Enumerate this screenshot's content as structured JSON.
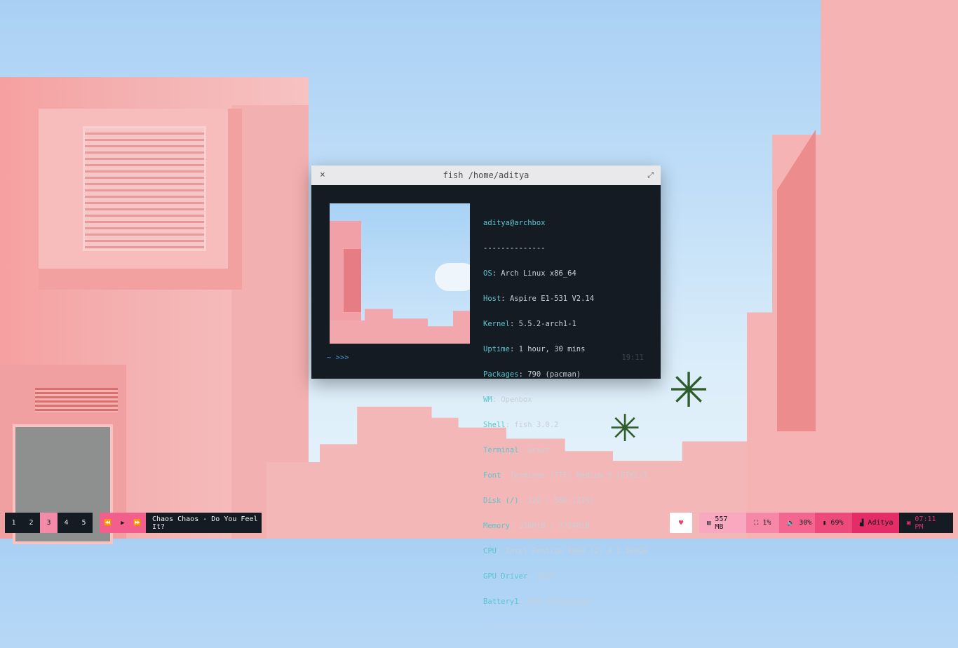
{
  "terminal": {
    "title": "fish /home/aditya",
    "close_icon": "×",
    "expand_icon": "⤢",
    "header": "aditya@archbox",
    "divider": "--------------",
    "info": [
      {
        "key": "OS",
        "value": " Arch Linux x86_64"
      },
      {
        "key": "Host",
        "value": " Aspire E1-531 V2.14"
      },
      {
        "key": "Kernel",
        "value": " 5.5.2-arch1-1"
      },
      {
        "key": "Uptime",
        "value": " 1 hour, 30 mins"
      },
      {
        "key": "Packages",
        "value": " 790 (pacman)"
      },
      {
        "key": "WM",
        "value": " Openbox"
      },
      {
        "key": "Shell",
        "value": " fish 3.0.2"
      },
      {
        "key": "Terminal",
        "value": " urxvt"
      },
      {
        "key": "Font",
        "value": " Terminus (TTF) Medium 9 [GTK2/3"
      },
      {
        "key": "Disk (/)",
        "value": " 12G / 58G (21%)"
      },
      {
        "key": "Memory",
        "value": " 336MiB / 3754MiB"
      },
      {
        "key": "CPU",
        "value": " Intel Pentium B960 (2) @ 2.200GH"
      },
      {
        "key": "GPU Driver",
        "value": " i915"
      },
      {
        "key": "Battery1",
        "value": " 68% [Charging]"
      }
    ],
    "footer_divider": "------------------------",
    "prompt": "~ >>>",
    "clock": "19:11"
  },
  "bar": {
    "workspaces": [
      "1",
      "2",
      "3",
      "4",
      "5"
    ],
    "active_workspace_index": 2,
    "media": {
      "prev_icon": "⏪",
      "play_icon": "▶",
      "next_icon": "⏩"
    },
    "song": "Chaos Chaos - Do You Feel It?",
    "heart_icon": "♥",
    "memory": {
      "icon": "▤",
      "value": "557 MB"
    },
    "cpu": {
      "icon": "⛶",
      "value": "1%"
    },
    "volume": {
      "icon": "🔈",
      "value": "30%"
    },
    "battery": {
      "icon": "▮",
      "value": "69%"
    },
    "wifi": {
      "icon": "▟",
      "value": "Aditya"
    },
    "time": {
      "icon": "▣",
      "value": "07:11 PM"
    }
  },
  "colors": {
    "accent_pink": "#e32c68",
    "bar_dark": "#151b22",
    "terminal_cyan": "#58c7cf"
  }
}
